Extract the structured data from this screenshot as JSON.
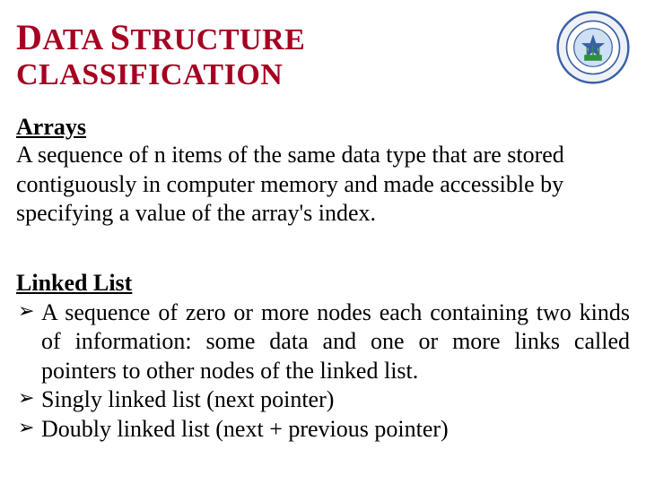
{
  "title": {
    "word1_firstcap": "D",
    "word1_rest": "ATA",
    "word2_firstcap": "S",
    "word2_rest": "TRUCTURE",
    "rest": "CLASSIFICATION"
  },
  "logo_name": "university-college-seal",
  "arrays": {
    "heading": "Arrays",
    "body": "A sequence of n items of the same data type that are stored contiguously in computer memory and made accessible by specifying a value of the array's index."
  },
  "linked_list": {
    "heading": "Linked List",
    "bullets": [
      "A sequence of zero or more nodes each containing two kinds of information: some data and one or more links called pointers to other nodes of the linked list.",
      "Singly linked list (next pointer)",
      "Doubly linked list (next + previous pointer)"
    ]
  }
}
